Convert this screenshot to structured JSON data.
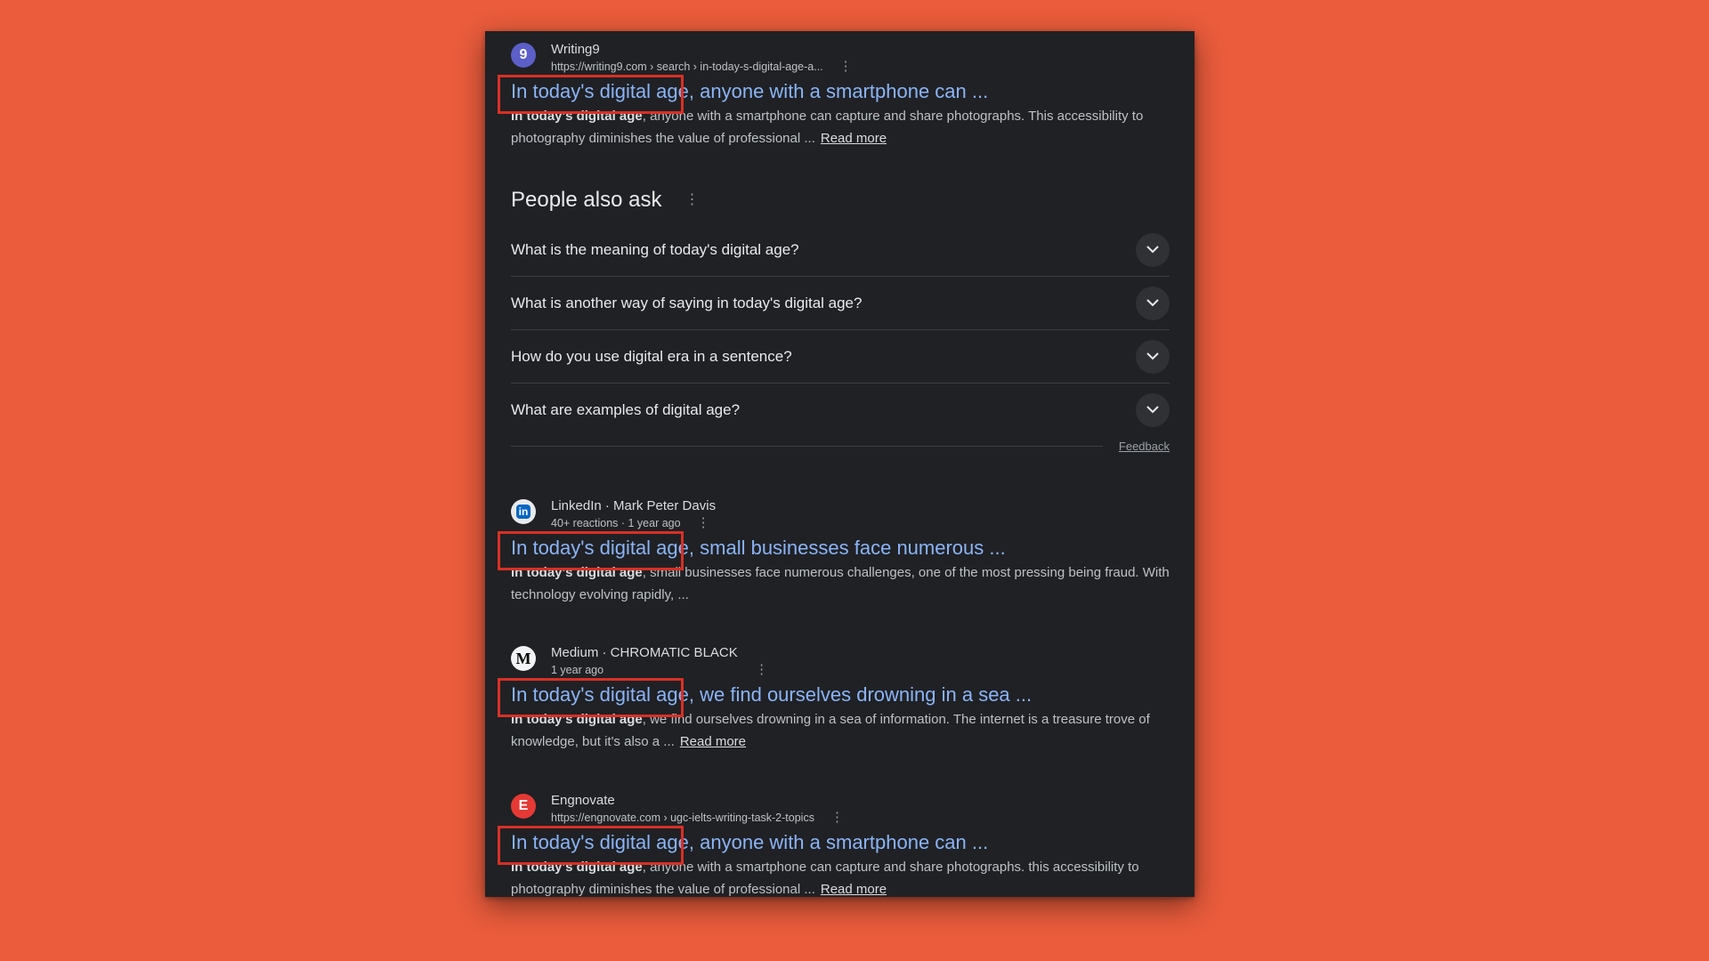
{
  "results": [
    {
      "site": "Writing9",
      "url": "https://writing9.com › search › in-today-s-digital-age-a...",
      "title_highlight": "In today's digital age,",
      "title_rest": " anyone with a smartphone can ...",
      "snippet_bold": "In today's digital age",
      "snippet_rest": ", anyone with a smartphone can capture and share photographs. This accessibility to photography diminishes the value of professional ...",
      "read_more": "Read more",
      "favicon_letter": "9"
    },
    {
      "site": "LinkedIn · Mark Peter Davis",
      "url": "40+ reactions · 1 year ago",
      "title_highlight": "In today's digital age,",
      "title_rest": " small businesses face numerous ...",
      "snippet_bold": "In today's digital age",
      "snippet_rest": ", small businesses face numerous challenges, one of the most pressing being fraud. With technology evolving rapidly, ...",
      "favicon_letter": "in"
    },
    {
      "site": "Medium · CHROMATIC BLACK",
      "url": "1 year ago",
      "title_highlight": "In today's digital age,",
      "title_rest": " we find ourselves drowning in a sea ...",
      "snippet_bold": "In today's digital age",
      "snippet_rest": ", we find ourselves drowning in a sea of information. The internet is a treasure trove of knowledge, but it's also a ...",
      "read_more": "Read more",
      "favicon_letter": "M"
    },
    {
      "site": "Engnovate",
      "url": "https://engnovate.com › ugc-ielts-writing-task-2-topics",
      "title_highlight": "In today's digital age,",
      "title_rest": " anyone with a smartphone can ...",
      "snippet_bold": "In today's digital age",
      "snippet_rest": ", anyone with a smartphone can capture and share photographs. this accessibility to photography diminishes the value of professional ...",
      "read_more": "Read more",
      "favicon_letter": "E"
    }
  ],
  "people_also_ask": {
    "heading": "People also ask",
    "questions": [
      "What is the meaning of today's digital age?",
      "What is another way of saying in today's digital age?",
      "How do you use digital era in a sentence?",
      "What are examples of digital age?"
    ],
    "feedback": "Feedback"
  },
  "colors": {
    "background": "#ea5c3c",
    "panel": "#202124",
    "link": "#8ab4f8",
    "highlight_box": "#d93025"
  },
  "icons": {
    "kebab": "more-vert-icon",
    "chevron": "chevron-down-icon"
  }
}
